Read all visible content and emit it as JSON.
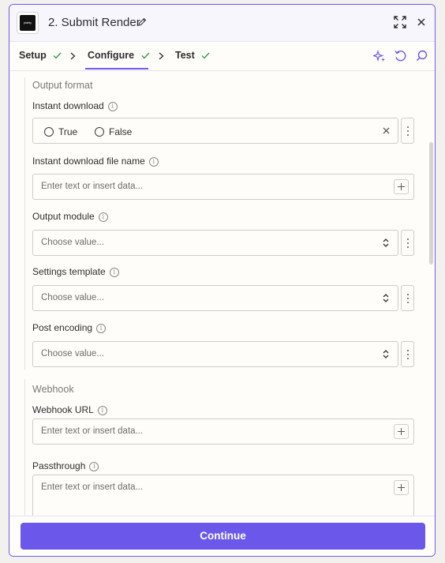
{
  "header": {
    "app_logo_text": "plainly",
    "title": "2. Submit Render"
  },
  "tabs": [
    {
      "label": "Setup"
    },
    {
      "label": "Configure"
    },
    {
      "label": "Test"
    }
  ],
  "colors": {
    "accent": "#6b58ea",
    "success": "#3a9a4b"
  },
  "sections": {
    "output_format": {
      "title": "Output format",
      "instant_download": {
        "label": "Instant download",
        "options": [
          "True",
          "False"
        ]
      },
      "instant_download_file_name": {
        "label": "Instant download file name",
        "placeholder": "Enter text or insert data..."
      },
      "output_module": {
        "label": "Output module",
        "placeholder": "Choose value..."
      },
      "settings_template": {
        "label": "Settings template",
        "placeholder": "Choose value..."
      },
      "post_encoding": {
        "label": "Post encoding",
        "placeholder": "Choose value..."
      }
    },
    "webhook": {
      "title": "Webhook",
      "webhook_url": {
        "label": "Webhook URL",
        "placeholder": "Enter text or insert data..."
      },
      "passthrough": {
        "label": "Passthrough",
        "placeholder": "Enter text or insert data..."
      }
    }
  },
  "footer": {
    "continue_label": "Continue"
  },
  "icons": [
    "edit-icon",
    "expand-icon",
    "close-icon",
    "check-icon",
    "chevron-right-icon",
    "ai-sparkle-icon",
    "undo-icon",
    "search-icon",
    "info-icon",
    "plus-icon",
    "updown-icon",
    "kebab-icon",
    "clear-icon"
  ]
}
